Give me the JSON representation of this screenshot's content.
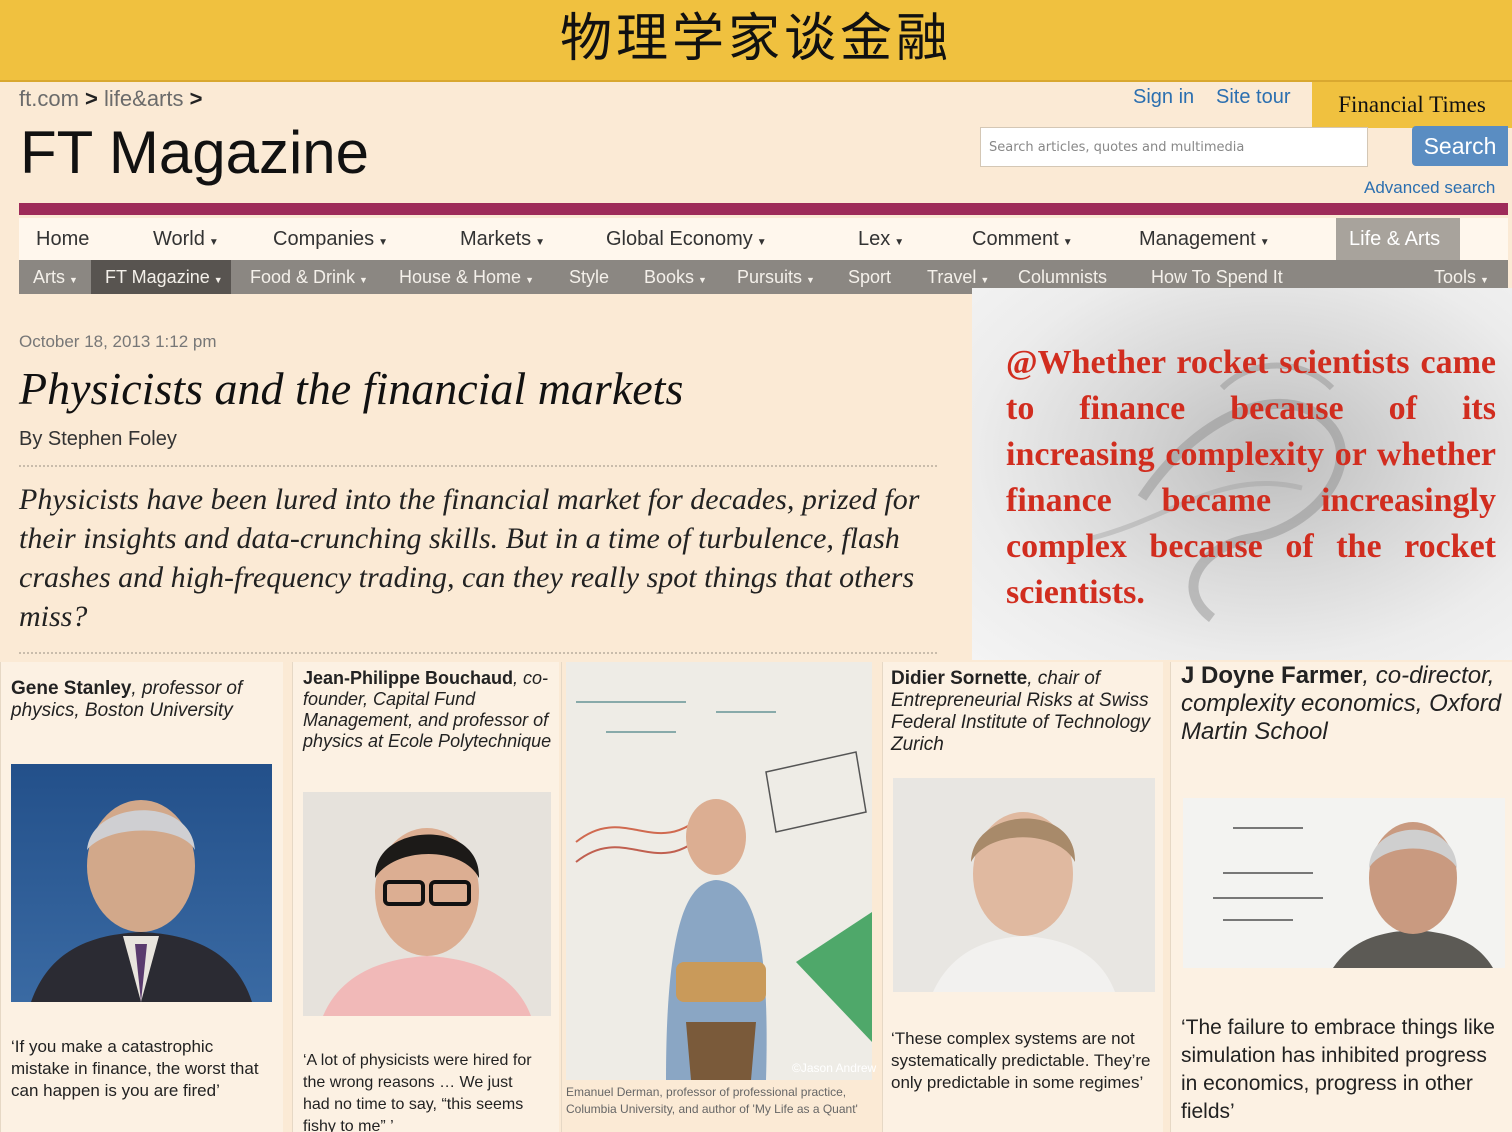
{
  "banner": {
    "title": "物理学家谈金融"
  },
  "breadcrumb": {
    "site": "ft.com",
    "section": "life&arts",
    "sep": ">"
  },
  "magazine_title": "FT Magazine",
  "header_links": {
    "sign_in": "Sign in",
    "site_tour": "Site tour"
  },
  "brand_tab": "Financial Times",
  "search": {
    "placeholder": "Search articles, quotes and multimedia",
    "button": "Search",
    "advanced": "Advanced search"
  },
  "nav_primary": [
    "Home",
    "World",
    "Companies",
    "Markets",
    "Global Economy",
    "Lex",
    "Comment",
    "Management",
    "Life & Arts"
  ],
  "nav_secondary": [
    "Arts",
    "FT Magazine",
    "Food & Drink",
    "House & Home",
    "Style",
    "Books",
    "Pursuits",
    "Sport",
    "Travel",
    "Columnists",
    "How To Spend It",
    "Tools"
  ],
  "article": {
    "date": "October 18, 2013 1:12 pm",
    "headline": "Physicists and the financial markets",
    "byline": "By Stephen Foley",
    "standfirst": "Physicists have been lured into the financial market for decades, prized for their insights and data-crunching skills. But in a time of turbulence, flash crashes and high-frequency trading, can they really spot things that others miss?"
  },
  "overlay_quote": "@Whether rocket scientists came to finance because of its increasing complexity or whether finance became increasingly complex because of the rocket scientists.",
  "people": [
    {
      "name": "Gene Stanley",
      "title": ", professor of physics, Boston University",
      "quote": "‘If you make a catastrophic mistake in finance, the worst that can happen is you are fired’"
    },
    {
      "name": "Jean-Philippe Bouchaud",
      "title": ", co-founder, Capital Fund Management, and professor of physics at Ecole Polytechnique",
      "quote": "‘A lot of physicists were hired for the wrong reasons … We just had no time to say, “this seems fishy to me” ’"
    },
    {
      "photo_credit": "©Jason Andrew",
      "caption": "Emanuel Derman, professor of professional practice, Columbia University, and author of 'My Life as a Quant'"
    },
    {
      "name": "Didier Sornette",
      "title": ", chair of Entrepreneurial Risks at Swiss Federal Institute of Technology Zurich",
      "quote": "‘These complex systems are not systematically predictable. They’re only predictable in some regimes’"
    },
    {
      "name": "J Doyne Farmer",
      "title": ", co-director, complexity economics, Oxford Martin School",
      "quote": "‘The failure to embrace things like simulation has inhibited progress in economics, progress in other fields’"
    }
  ]
}
